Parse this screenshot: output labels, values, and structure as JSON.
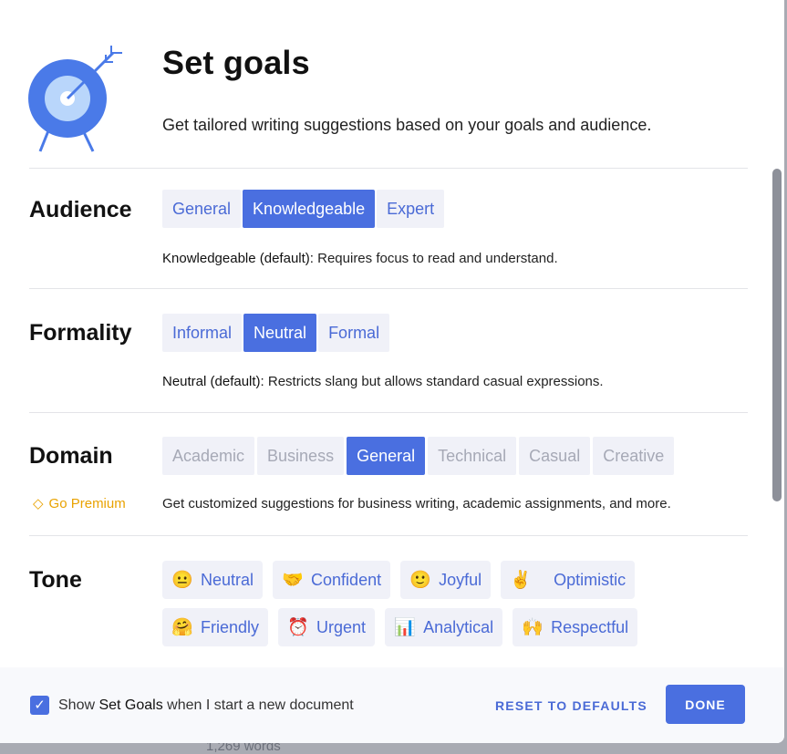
{
  "header": {
    "title": "Set goals",
    "subtitle": "Get tailored writing suggestions based on your goals and audience."
  },
  "audience": {
    "label": "Audience",
    "options": [
      "General",
      "Knowledgeable",
      "Expert"
    ],
    "selected": "Knowledgeable",
    "desc_strong": "Knowledgeable (default):",
    "desc": " Requires focus to read and understand."
  },
  "formality": {
    "label": "Formality",
    "options": [
      "Informal",
      "Neutral",
      "Formal"
    ],
    "selected": "Neutral",
    "desc_strong": "Neutral (default):",
    "desc": " Restricts slang but allows standard casual expressions."
  },
  "domain": {
    "label": "Domain",
    "options": [
      "Academic",
      "Business",
      "General",
      "Technical",
      "Casual",
      "Creative"
    ],
    "selected": "General",
    "premium": "Go Premium",
    "desc": "Get customized suggestions for business writing, academic assignments, and more."
  },
  "tone": {
    "label": "Tone",
    "options": [
      {
        "emoji": "😐",
        "label": "Neutral"
      },
      {
        "emoji": "🤝",
        "label": "Confident"
      },
      {
        "emoji": "🙂",
        "label": "Joyful"
      },
      {
        "emoji": "✌️",
        "label": "Optimistic"
      },
      {
        "emoji": "🤗",
        "label": "Friendly"
      },
      {
        "emoji": "⏰",
        "label": "Urgent"
      },
      {
        "emoji": "📊",
        "label": "Analytical"
      },
      {
        "emoji": "🙌",
        "label": "Respectful"
      }
    ]
  },
  "footer": {
    "show_pre": "Show ",
    "show_bold": "Set Goals",
    "show_post": " when I start a new document",
    "checked": true,
    "reset": "RESET TO DEFAULTS",
    "done": "DONE"
  },
  "background": {
    "word_count": "1,269 words"
  },
  "colors": {
    "accent": "#4a6fe0",
    "premium": "#e9a200"
  }
}
